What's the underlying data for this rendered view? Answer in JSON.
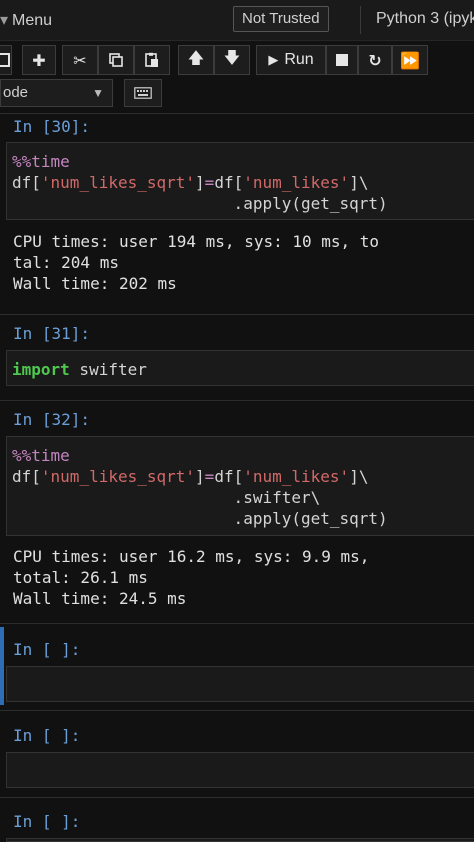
{
  "header": {
    "menu_label": "Menu",
    "trust_label": "Not Trusted",
    "kernel_label": "Python 3 (ipyk"
  },
  "toolbar": {
    "run_label": "Run",
    "cell_type_value": "ode"
  },
  "cells": [
    {
      "prompt": "In [30]:",
      "code": [
        {
          "magic": "%%time"
        },
        {
          "pre": "df[",
          "s1": "'num_likes_sqrt'",
          "mid": "]",
          "op": "=",
          "post": "df[",
          "s2": "'num_likes'",
          "tail": "]\\"
        },
        {
          "text": "                       .apply(get_sqrt)"
        }
      ],
      "output": [
        "CPU times: user 194 ms, sys: 10 ms, to",
        "tal: 204 ms",
        "Wall time: 202 ms"
      ]
    },
    {
      "prompt": "In [31]:",
      "code": [
        {
          "keyword": "import",
          "text": " swifter"
        }
      ]
    },
    {
      "prompt": "In [32]:",
      "code": [
        {
          "magic": "%%time"
        },
        {
          "pre": "df[",
          "s1": "'num_likes_sqrt'",
          "mid": "]",
          "op": "=",
          "post": "df[",
          "s2": "'num_likes'",
          "tail": "]\\"
        },
        {
          "text": "                       .swifter\\"
        },
        {
          "text": "                       .apply(get_sqrt)"
        }
      ],
      "output": [
        "CPU times: user 16.2 ms, sys: 9.9 ms,",
        "total: 26.1 ms",
        "Wall time: 24.5 ms"
      ]
    },
    {
      "prompt": "In [ ]:"
    },
    {
      "prompt": "In [ ]:"
    },
    {
      "prompt": "In [ ]:"
    }
  ]
}
